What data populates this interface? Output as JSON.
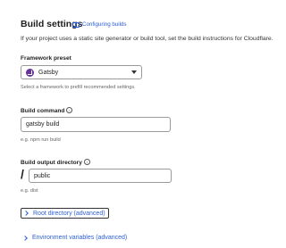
{
  "header": {
    "title": "Build settings",
    "badge_label": "Configuring builds",
    "subtitle": "If your project uses a static site generator or build tool, set the build instructions for Cloudflare."
  },
  "framework_preset": {
    "label": "Framework preset",
    "value": "Gatsby",
    "help": "Select a framework to prefill recommended settings.",
    "icon": "gatsby-logo"
  },
  "build_command": {
    "label": "Build command",
    "info_glyph": "i",
    "value": "gatsby build",
    "help": "e.g. npm run build"
  },
  "build_output": {
    "label": "Build output directory",
    "info_glyph": "i",
    "prefix": "/",
    "value": "public",
    "help": "e.g. dist"
  },
  "sections": {
    "root_directory": "Root directory (advanced)",
    "env_vars": "Environment variables (advanced)"
  },
  "colors": {
    "accent": "#2c5fd6",
    "gatsby": "#663399",
    "border": "#9a9a9a"
  }
}
